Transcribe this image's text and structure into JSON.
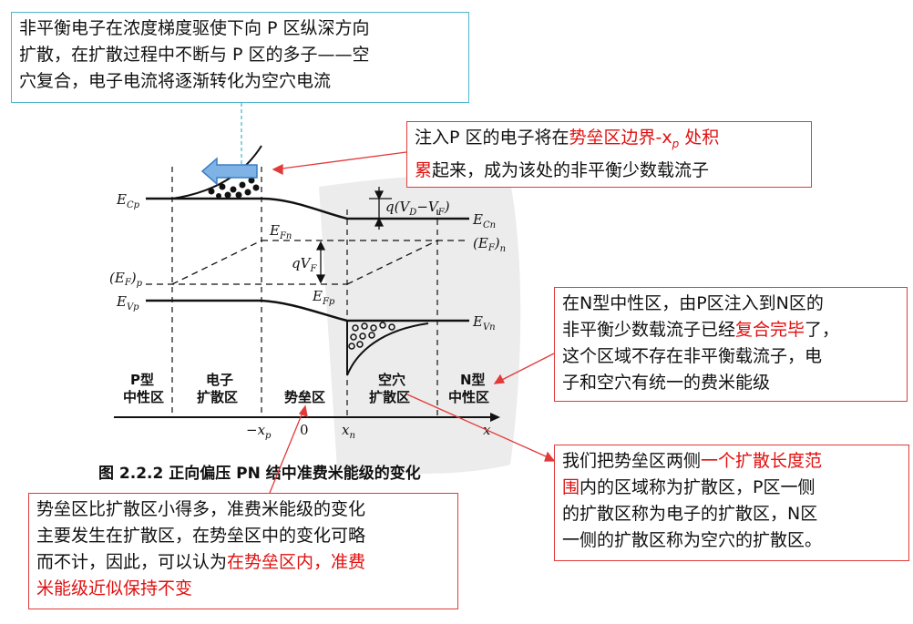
{
  "notes": {
    "top": {
      "lines": [
        "非平衡电子在浓度梯度驱使下向 P 区纵深方向",
        "扩散，在扩散过程中不断与 P 区的多子——空",
        "穴复合，电子电流将逐渐转化为空穴电流"
      ]
    },
    "inject": {
      "line1_a": "注入P 区的电子将在",
      "line1_red": "势垒区边界-x",
      "line1_red_sub": "p",
      "line1_red_b": " 处积",
      "line2_red": "累",
      "line2_b": "起来，成为该处的非平衡少数载流子"
    },
    "n_region": {
      "line1": "在N型中性区，由P区注入到N区的",
      "line2_a": "非平衡少数载流子已经",
      "line2_red": "复合完毕",
      "line2_b": "了，",
      "line3": "这个区域不存在非平衡载流子，电",
      "line4": "子和空穴有统一的费米能级"
    },
    "diffusion": {
      "line1_a": "我们把势垒区两侧",
      "line1_red": "一个扩散长度范",
      "line2_red": "围",
      "line2_b": "内的区域称为扩散区，P区一侧",
      "line3": "的扩散区称为电子的扩散区，N区",
      "line4": "一侧的扩散区称为空穴的扩散区。"
    },
    "barrier": {
      "line1": "势垒区比扩散区小得多，准费米能级的变化",
      "line2": "主要发生在扩散区，在势垒区中的变化可略",
      "line3_a": "而不计，因此，可以认为",
      "line3_red": "在势垒区内，准费",
      "line4_red": "米能级近似保持不变"
    }
  },
  "diagram": {
    "labels": {
      "ecp": "E",
      "ecp_sub": "Cp",
      "ecn": "E",
      "ecn_sub": "Cn",
      "evp": "E",
      "evp_sub": "Vp",
      "evn": "E",
      "evn_sub": "Vn",
      "efp": "(E",
      "efp_mid": "F",
      "efp_close": ")",
      "efp_sub": "p",
      "efn": "(E",
      "efn_mid": "F",
      "efn_close": ")",
      "efn_sub": "n",
      "efn_inner": "E",
      "efn_inner_sub": "Fn",
      "efp_inner": "E",
      "efp_inner_sub": "Fp",
      "qv_top": "q(V",
      "qv_top_sub1": "D",
      "qv_top_mid": "−V",
      "qv_top_sub2": "F",
      "qv_top_close": ")",
      "qvf": "qV",
      "qvf_sub": "F"
    },
    "regions": {
      "p_neutral": [
        "P型",
        "中性区"
      ],
      "e_diff": [
        "电子",
        "扩散区"
      ],
      "barrier": "势垒区",
      "h_diff": [
        "空穴",
        "扩散区"
      ],
      "n_neutral": [
        "N型",
        "中性区"
      ]
    },
    "axis": {
      "minus_xp": "−x",
      "minus_xp_sub": "p",
      "zero": "0",
      "xn": "x",
      "xn_sub": "n",
      "x": "x"
    },
    "caption": "图 2.2.2   正向偏压 PN 结中准费米能级的变化"
  },
  "colors": {
    "red_text": "#e01010",
    "cyan_border": "#4fb6cf",
    "red_border": "#e23a3a",
    "arrow_fill": "#7fb3e6"
  }
}
